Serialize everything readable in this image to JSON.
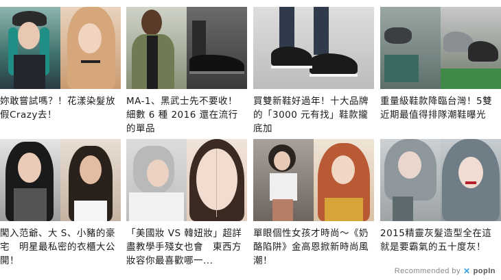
{
  "cards": [
    {
      "title": "妳敢嘗試嗎？！花漾染髮放假Crazy去！"
    },
    {
      "title": "MA-1、黑武士先不要收！細數 6 種 2016 還在流行的單品"
    },
    {
      "title": "買雙新鞋好過年！十大品牌的「3000 元有找」鞋款攏底加"
    },
    {
      "title": "重量級鞋款降臨台灣！5雙近期最值得排隊潮鞋曝光"
    },
    {
      "title": "闖入范爺、大 S、小豬的豪宅　明星最私密的衣櫃大公開！"
    },
    {
      "title": "「美國妝 VS 韓妞妝」超詳盡教學手殘女也會　東西方妝容你最喜歡哪一..."
    },
    {
      "title": "單眼個性女孩才時尚～《奶酪陷阱》金高恩掀新時尚風潮！"
    },
    {
      "title": "2015精靈灰髮造型全在這就是要霸氣的五十度灰！"
    }
  ],
  "footer": {
    "recommended_by": "Recommended by",
    "brand": "popIn",
    "brand_icon": "popin-x-icon"
  }
}
